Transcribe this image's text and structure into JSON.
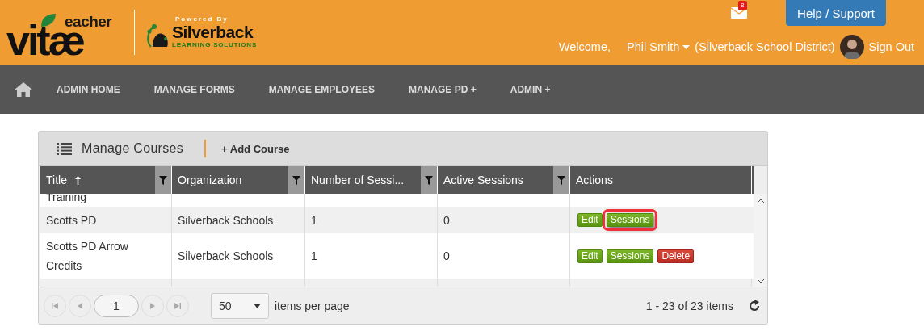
{
  "header": {
    "logo": {
      "top": "eacher",
      "main": "vitæ"
    },
    "partner": {
      "powered_by": "Powered By",
      "name": "Silverback",
      "tagline": "LEARNING SOLUTIONS"
    },
    "mail_badge": "8",
    "help_button": "Help / Support",
    "welcome": "Welcome,",
    "user": "Phil Smith",
    "district": "(Silverback School District)",
    "sign_out": "Sign Out"
  },
  "nav": {
    "items": [
      {
        "label": "ADMIN HOME"
      },
      {
        "label": "MANAGE FORMS"
      },
      {
        "label": "MANAGE EMPLOYEES"
      },
      {
        "label": "MANAGE PD +"
      },
      {
        "label": "ADMIN +"
      }
    ]
  },
  "panel": {
    "title": "Manage Courses",
    "add_button": "+ Add Course",
    "table": {
      "columns": [
        {
          "label": "Title",
          "sorted": true,
          "filter": true
        },
        {
          "label": "Organization",
          "sorted": false,
          "filter": true
        },
        {
          "label": "Number of Sessi...",
          "sorted": false,
          "filter": true
        },
        {
          "label": "Active Sessions",
          "sorted": false,
          "filter": true
        },
        {
          "label": "Actions",
          "sorted": false,
          "filter": false
        }
      ],
      "rows": [
        {
          "cells": [
            "Training",
            "",
            "",
            ""
          ],
          "actions": []
        },
        {
          "cells": [
            "Scotts PD",
            "Silverback Schools",
            "1",
            "0"
          ],
          "actions": [
            {
              "kind": "edit",
              "label": "Edit",
              "highlighted": false
            },
            {
              "kind": "sessions",
              "label": "Sessions",
              "highlighted": true
            }
          ]
        },
        {
          "cells": [
            "Scotts PD Arrow Credits",
            "Silverback Schools",
            "1",
            "0"
          ],
          "actions": [
            {
              "kind": "edit",
              "label": "Edit",
              "highlighted": false
            },
            {
              "kind": "sessions",
              "label": "Sessions",
              "highlighted": false
            },
            {
              "kind": "delete",
              "label": "Delete",
              "highlighted": false
            }
          ]
        }
      ]
    },
    "pager": {
      "page": "1",
      "page_size": "50",
      "per_page_label": "items per page",
      "summary": "1 - 23 of 23 items"
    }
  }
}
